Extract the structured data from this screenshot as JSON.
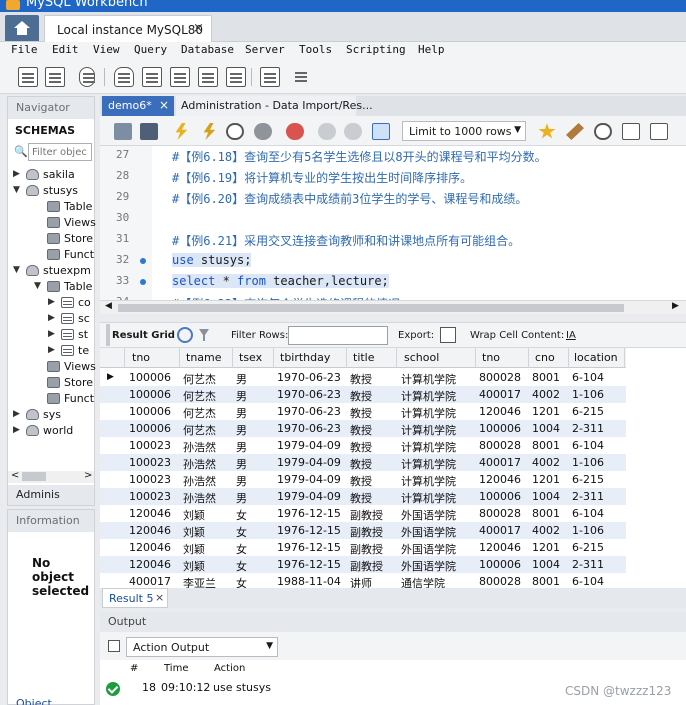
{
  "window": {
    "title": "MySQL Workbench"
  },
  "tabs": {
    "instance": "Local instance MySQL80",
    "close": "×"
  },
  "menu": [
    "File",
    "Edit",
    "View",
    "Query",
    "Database",
    "Server",
    "Tools",
    "Scripting",
    "Help"
  ],
  "navigator": {
    "title": "Navigator",
    "schemas_label": "SCHEMAS",
    "filter_placeholder": "Filter objec",
    "tree": [
      {
        "label": "sakila",
        "level": 0,
        "icon": "database-icon",
        "arrow": "▶"
      },
      {
        "label": "stusys",
        "level": 0,
        "icon": "database-icon",
        "arrow": "▼"
      },
      {
        "label": "Table",
        "level": 1,
        "icon": "folder-icon",
        "arrow": ""
      },
      {
        "label": "Views",
        "level": 1,
        "icon": "folder-icon",
        "arrow": ""
      },
      {
        "label": "Store",
        "level": 1,
        "icon": "folder-icon",
        "arrow": ""
      },
      {
        "label": "Funct",
        "level": 1,
        "icon": "folder-icon",
        "arrow": ""
      },
      {
        "label": "stuexpm",
        "level": 0,
        "icon": "database-icon",
        "arrow": "▼"
      },
      {
        "label": "Table",
        "level": 1,
        "icon": "folder-icon",
        "arrow": "▼"
      },
      {
        "label": "co",
        "level": 2,
        "icon": "table-icon",
        "arrow": "▶"
      },
      {
        "label": "sc",
        "level": 2,
        "icon": "table-icon",
        "arrow": "▶"
      },
      {
        "label": "st",
        "level": 2,
        "icon": "table-icon",
        "arrow": "▶"
      },
      {
        "label": "te",
        "level": 2,
        "icon": "table-icon",
        "arrow": "▶"
      },
      {
        "label": "Views",
        "level": 1,
        "icon": "folder-icon",
        "arrow": ""
      },
      {
        "label": "Store",
        "level": 1,
        "icon": "folder-icon",
        "arrow": ""
      },
      {
        "label": "Funct",
        "level": 1,
        "icon": "folder-icon",
        "arrow": ""
      },
      {
        "label": "sys",
        "level": 0,
        "icon": "database-icon",
        "arrow": "▶"
      },
      {
        "label": "world",
        "level": 0,
        "icon": "database-icon",
        "arrow": "▶"
      }
    ],
    "admin_label": "Adminis",
    "scroll_left": "<",
    "scroll_right": ">"
  },
  "information": {
    "title": "Information",
    "empty_line1": "No",
    "empty_line2": "object",
    "empty_line3": "selected",
    "object_tab": "Object"
  },
  "editor_tabs": [
    {
      "label": "demo6*",
      "active": true,
      "close": "×"
    },
    {
      "label": "Administration - Data Import/Res...",
      "active": false
    }
  ],
  "sql_toolbar": {
    "limit": "Limit to 1000 rows",
    "dropdown": "▼"
  },
  "code_lines": [
    {
      "ln": "27",
      "dot": false,
      "selected": false,
      "tokens": [
        {
          "t": "#【例6.18】查询至少有5名学生选修且以8开头的课程号和平均分数。",
          "c": "cm"
        }
      ]
    },
    {
      "ln": "28",
      "dot": false,
      "selected": false,
      "tokens": [
        {
          "t": "#【例6.19】将计算机专业的学生按出生时间降序排序。",
          "c": "cm"
        }
      ]
    },
    {
      "ln": "29",
      "dot": false,
      "selected": false,
      "tokens": [
        {
          "t": "#【例6.20】查询成绩表中成绩前3位学生的学号、课程号和成绩。",
          "c": "cm"
        }
      ]
    },
    {
      "ln": "30",
      "dot": false,
      "selected": false,
      "tokens": []
    },
    {
      "ln": "31",
      "dot": false,
      "selected": false,
      "tokens": [
        {
          "t": "#【例6.21】采用交叉连接查询教师和和讲课地点所有可能组合。",
          "c": "cm"
        }
      ]
    },
    {
      "ln": "32",
      "dot": true,
      "selected": true,
      "tokens": [
        {
          "t": "use",
          "c": "kw"
        },
        {
          "t": " stusys;",
          "c": "id"
        }
      ]
    },
    {
      "ln": "33",
      "dot": true,
      "selected": true,
      "tokens": [
        {
          "t": "select",
          "c": "kw"
        },
        {
          "t": " * ",
          "c": "id"
        },
        {
          "t": "from",
          "c": "kw"
        },
        {
          "t": " teacher,lecture;",
          "c": "id"
        }
      ]
    },
    {
      "ln": "34",
      "dot": false,
      "selected": false,
      "tokens": [
        {
          "t": "#【例6.22】查询每个学生选修课程的情况",
          "c": "cm"
        }
      ]
    }
  ],
  "result_toolbar": {
    "result_grid": "Result Grid",
    "filter_rows": "Filter Rows:",
    "export": "Export:",
    "wrap": "Wrap Cell Content:",
    "wrap_icon": "IA"
  },
  "grid": {
    "columns": [
      "tno",
      "tname",
      "tsex",
      "tbirthday",
      "title",
      "school",
      "tno",
      "cno",
      "location"
    ],
    "rows": [
      [
        "100006",
        "何艺杰",
        "男",
        "1970-06-23",
        "教授",
        "计算机学院",
        "800028",
        "8001",
        "6-104"
      ],
      [
        "100006",
        "何艺杰",
        "男",
        "1970-06-23",
        "教授",
        "计算机学院",
        "400017",
        "4002",
        "1-106"
      ],
      [
        "100006",
        "何艺杰",
        "男",
        "1970-06-23",
        "教授",
        "计算机学院",
        "120046",
        "1201",
        "6-215"
      ],
      [
        "100006",
        "何艺杰",
        "男",
        "1970-06-23",
        "教授",
        "计算机学院",
        "100006",
        "1004",
        "2-311"
      ],
      [
        "100023",
        "孙浩然",
        "男",
        "1979-04-09",
        "教授",
        "计算机学院",
        "800028",
        "8001",
        "6-104"
      ],
      [
        "100023",
        "孙浩然",
        "男",
        "1979-04-09",
        "教授",
        "计算机学院",
        "400017",
        "4002",
        "1-106"
      ],
      [
        "100023",
        "孙浩然",
        "男",
        "1979-04-09",
        "教授",
        "计算机学院",
        "120046",
        "1201",
        "6-215"
      ],
      [
        "100023",
        "孙浩然",
        "男",
        "1979-04-09",
        "教授",
        "计算机学院",
        "100006",
        "1004",
        "2-311"
      ],
      [
        "120046",
        "刘颖",
        "女",
        "1976-12-15",
        "副教授",
        "外国语学院",
        "800028",
        "8001",
        "6-104"
      ],
      [
        "120046",
        "刘颖",
        "女",
        "1976-12-15",
        "副教授",
        "外国语学院",
        "400017",
        "4002",
        "1-106"
      ],
      [
        "120046",
        "刘颖",
        "女",
        "1976-12-15",
        "副教授",
        "外国语学院",
        "120046",
        "1201",
        "6-215"
      ],
      [
        "120046",
        "刘颖",
        "女",
        "1976-12-15",
        "副教授",
        "外国语学院",
        "100006",
        "1004",
        "2-311"
      ],
      [
        "400017",
        "李亚兰",
        "女",
        "1988-11-04",
        "讲师",
        "通信学院",
        "800028",
        "8001",
        "6-104"
      ]
    ]
  },
  "result_tab": {
    "label": "Result 5",
    "close": "×"
  },
  "output": {
    "title": "Output",
    "selector": "Action Output",
    "dropdown": "▼",
    "columns": [
      "#",
      "Time",
      "Action"
    ],
    "row": {
      "num": "18",
      "time": "09:10:12",
      "action": "use stusys"
    }
  },
  "watermark": "CSDN @twzzz123",
  "colors": {
    "accent": "#3a6ebd",
    "titlebar": "#1f66c6",
    "row_alt": "#e8eef8",
    "ok": "#1f9a3d"
  }
}
